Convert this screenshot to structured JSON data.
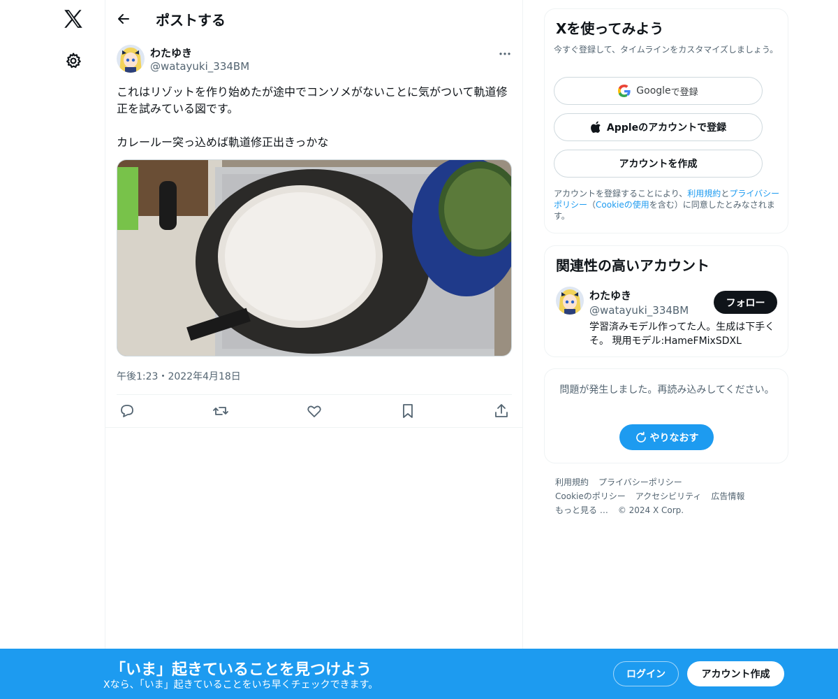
{
  "header": {
    "title": "ポストする"
  },
  "post": {
    "author_name": "わたゆき",
    "author_handle": "@watayuki_334BM",
    "text": "これはリゾットを作り始めたが途中でコンソメがないことに気がついて軌道修正を試みている図です。\n\nカレールー突っ込めば軌道修正出きっかな",
    "timestamp": "午後1:23・2022年4月18日"
  },
  "signup": {
    "title": "Xを使ってみよう",
    "subtitle": "今すぐ登録して、タイムラインをカスタマイズしましょう。",
    "google_label_brand": "Google",
    "google_label_rest": " で登録",
    "apple_label": "Appleのアカウントで登録",
    "create_label": "アカウントを作成",
    "legal_pre": "アカウントを登録することにより、",
    "legal_terms": "利用規約",
    "legal_and": "と",
    "legal_privacy": "プライバシーポリシー",
    "legal_paren_open": "（",
    "legal_cookie": "Cookieの使用",
    "legal_post": "を含む）に同意したとみなされます。"
  },
  "related": {
    "title": "関連性の高いアカウント",
    "name": "わたゆき",
    "handle": "@watayuki_334BM",
    "follow_label": "フォロー",
    "bio": "学習済みモデル作ってた人。生成は下手くそ。 現用モデル:HameFMixSDXL"
  },
  "error_card": {
    "message": "問題が発生しました。再読み込みしてください。",
    "retry_label": "やりなおす"
  },
  "footer": {
    "links": [
      "利用規約",
      "プライバシーポリシー",
      "Cookieのポリシー",
      "アクセシビリティ",
      "広告情報",
      "もっと見る …"
    ],
    "copyright": "© 2024 X Corp."
  },
  "banner": {
    "title": "「いま」起きていることを見つけよう",
    "subtitle": "Xなら、「いま」起きていることをいち早くチェックできます。",
    "login_label": "ログイン",
    "create_label": "アカウント作成"
  },
  "colors": {
    "accent": "#1d9bf0",
    "text": "#0f1419",
    "muted": "#536471",
    "border": "#eff3f4"
  }
}
